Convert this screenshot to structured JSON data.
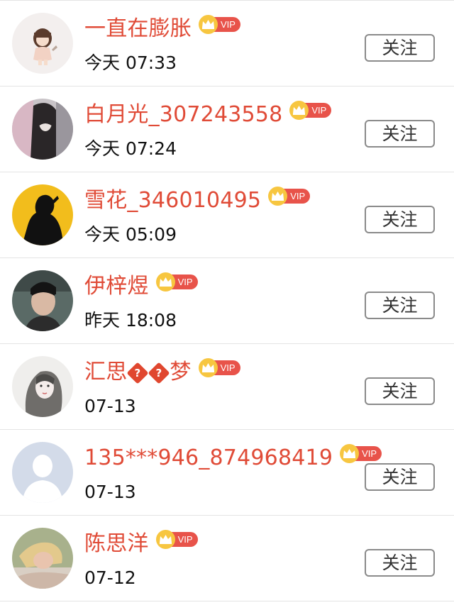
{
  "follow_label": "关注",
  "vip_label": "VIP",
  "colors": {
    "name": "#e04b37",
    "vip_badge": "#e8534a",
    "vip_crown": "#f7c640",
    "divider": "#e4e4e4"
  },
  "users": [
    {
      "name": "一直在膨胀",
      "time": "今天 07:33",
      "avatar_icon": "girl-doll-avatar"
    },
    {
      "name": "白月光_307243558",
      "time": "今天 07:24",
      "avatar_icon": "long-hair-figure-avatar"
    },
    {
      "name": "雪花_346010495",
      "time": "今天 05:09",
      "avatar_icon": "silhouette-yellow-avatar"
    },
    {
      "name": "伊梓煜",
      "time": "昨天 18:08",
      "avatar_icon": "young-man-photo-avatar"
    },
    {
      "name_parts": [
        "汇思",
        "?",
        "?",
        "梦"
      ],
      "time": "07-13",
      "avatar_icon": "sketch-girl-avatar"
    },
    {
      "name": "135***946_874968419",
      "time": "07-13",
      "avatar_icon": "default-person-avatar"
    },
    {
      "name": "陈思洋",
      "time": "07-12",
      "avatar_icon": "blonde-photo-avatar"
    }
  ]
}
